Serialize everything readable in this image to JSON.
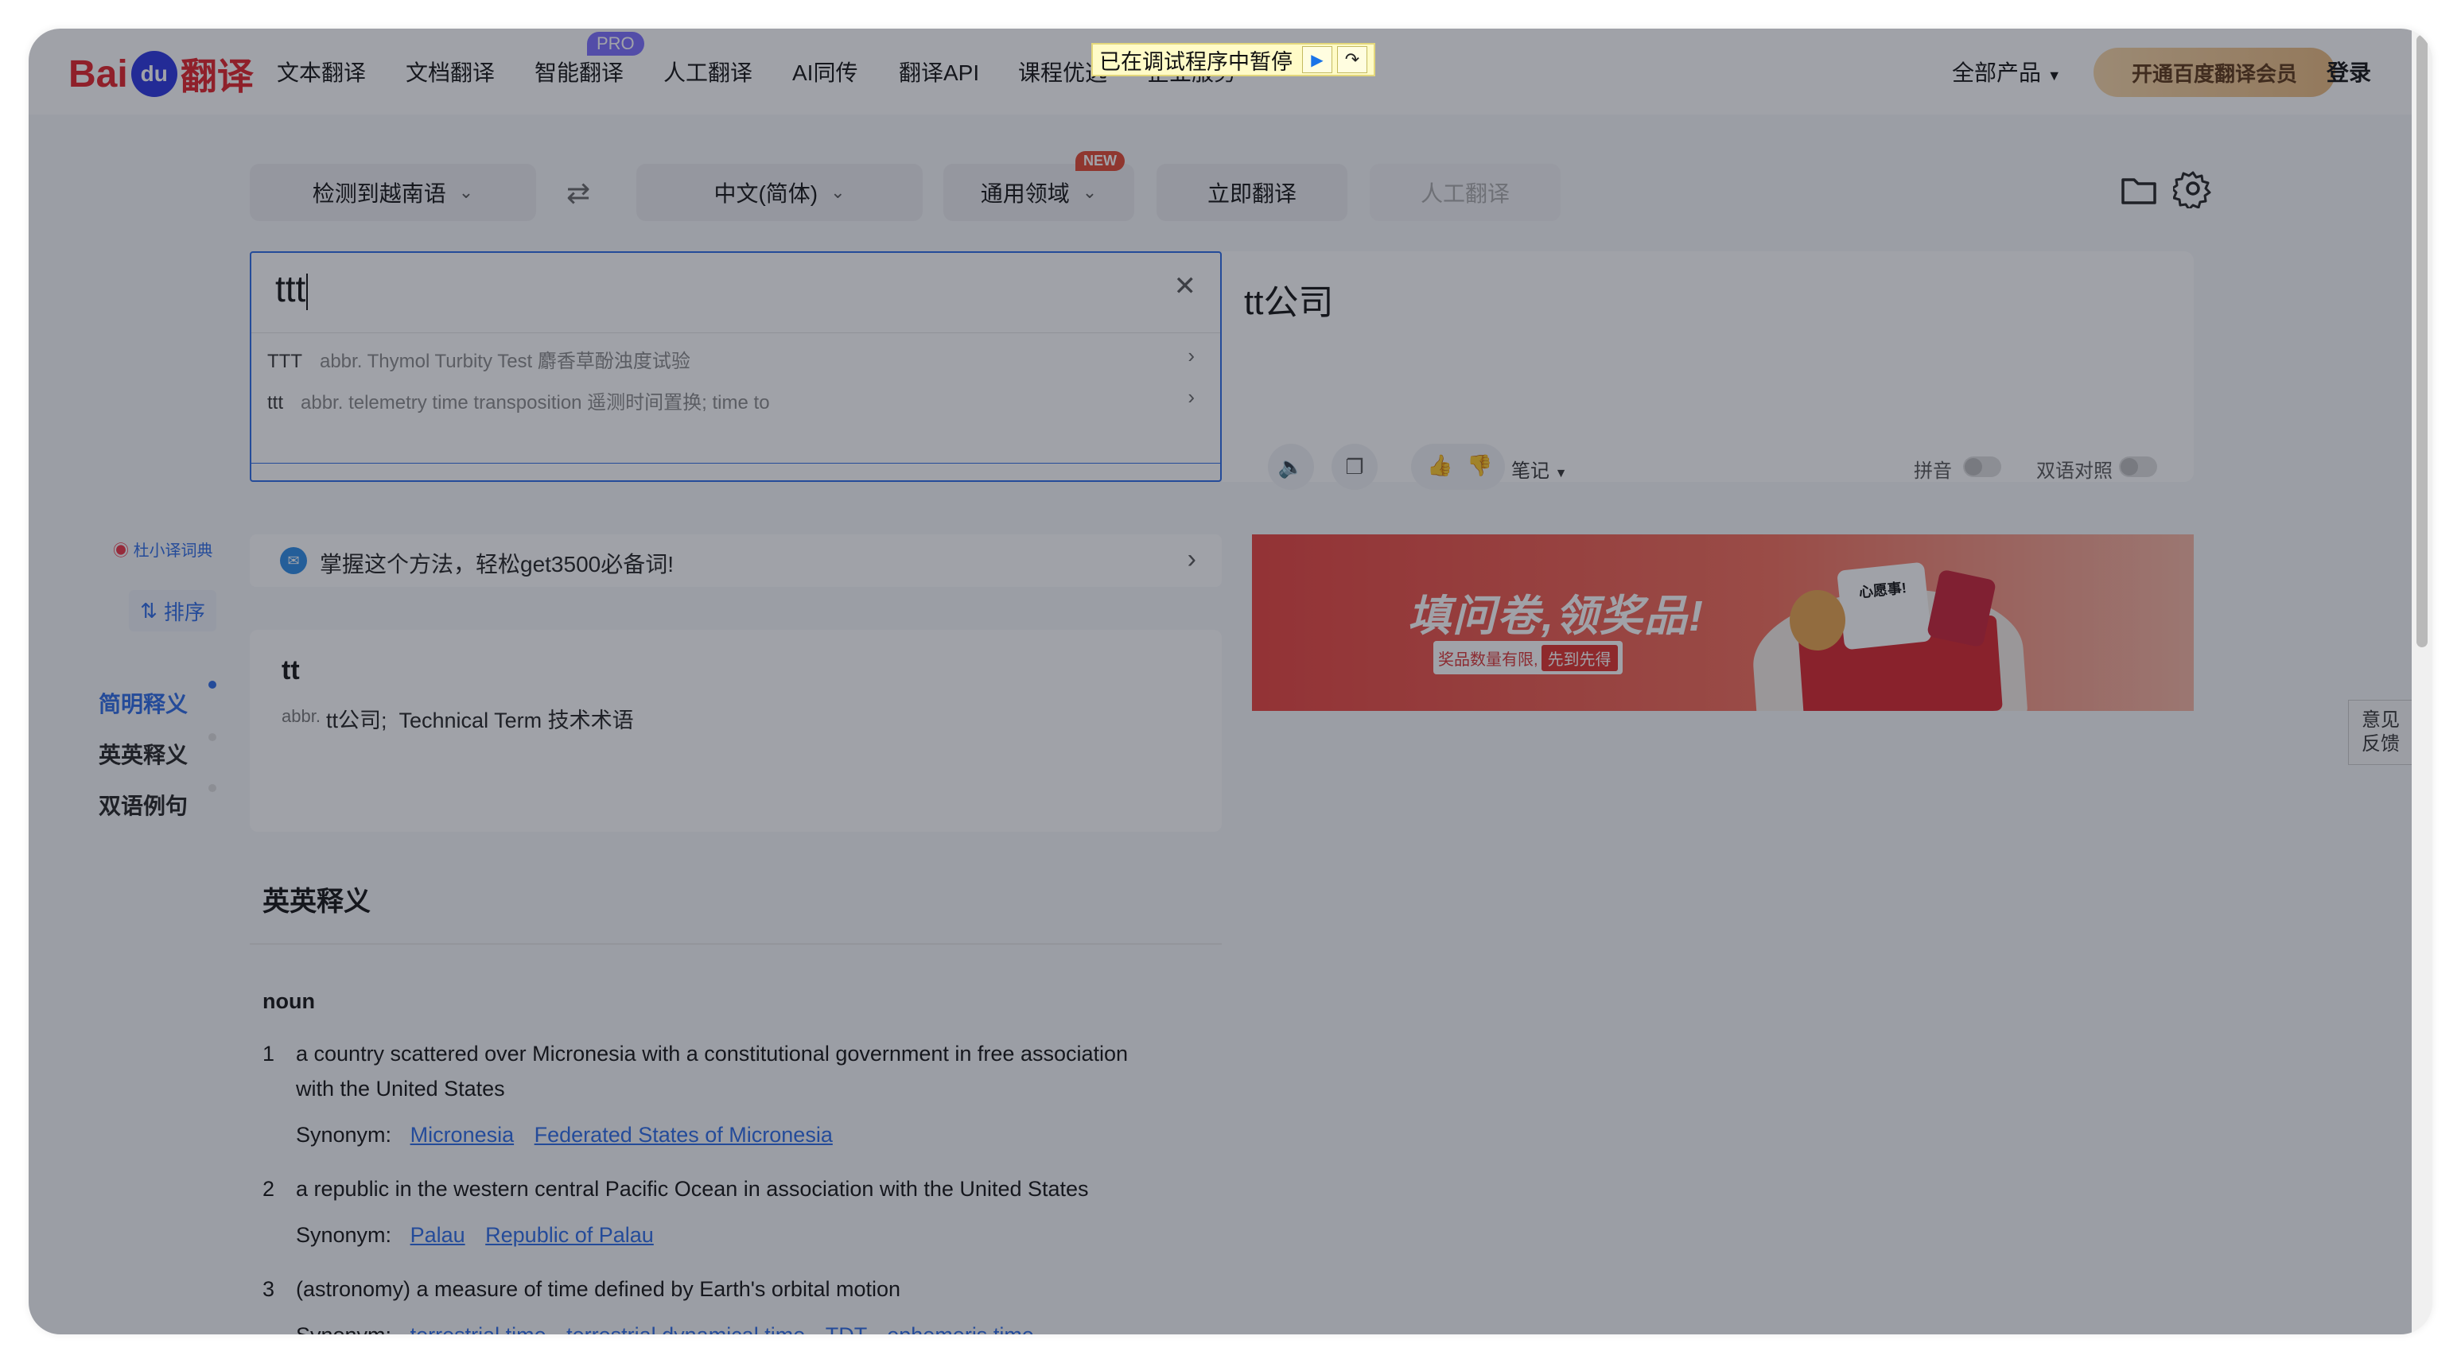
{
  "header": {
    "logo_bai": "Bai",
    "logo_du": "du",
    "logo_fanyi": "翻译",
    "nav": [
      "文本翻译",
      "文档翻译",
      "智能翻译",
      "人工翻译",
      "AI同传",
      "翻译API",
      "课程优选",
      "企业服务"
    ],
    "pro_badge": "PRO",
    "all_products": "全部产品",
    "vip_button": "开通百度翻译会员",
    "login": "登录"
  },
  "debug_banner": {
    "text": "已在调试程序中暂停"
  },
  "toolbar": {
    "source_lang": "检测到越南语",
    "target_lang": "中文(简体)",
    "domain": "通用领域",
    "new_badge": "NEW",
    "translate_button": "立即翻译",
    "human_translate_button": "人工翻译"
  },
  "input": {
    "text": "ttt",
    "suggestions": [
      {
        "word": "TTT",
        "definition": "abbr. Thymol Turbity Test 麝香草酚浊度试验"
      },
      {
        "word": "ttt",
        "definition": "abbr. telemetry time transposition 遥测时间置换; time to"
      }
    ]
  },
  "output": {
    "text": "tt公司",
    "notes_label": "笔记",
    "pinyin_label": "拼音",
    "bilingual_label": "双语对照"
  },
  "sidebar": {
    "dict_source": "杜小译词典",
    "sort_button": "排序",
    "items": [
      "简明释义",
      "英英释义",
      "双语例句"
    ]
  },
  "promo": {
    "text": "掌握这个方法，轻松get3500必备词!"
  },
  "brief_definition": {
    "headword": "tt",
    "pos": "abbr.",
    "meaning": "tt公司;  Technical Term 技术术语"
  },
  "banner": {
    "headline": "填问卷,领奖品!",
    "subline": "奖品数量有限,",
    "cta": "先到先得",
    "bag_text": "心愿事!"
  },
  "feedback": {
    "line1": "意见",
    "line2": "反馈"
  },
  "english_definitions": {
    "title": "英英释义",
    "pos": "noun",
    "synonym_label": "Synonym:",
    "senses": [
      {
        "num": "1",
        "text": "a country scattered over Micronesia with a constitutional government in free association",
        "text2": "with the United States",
        "synonyms": [
          "Micronesia",
          "Federated States of Micronesia"
        ]
      },
      {
        "num": "2",
        "text": "a republic in the western central Pacific Ocean in association with the United States",
        "synonyms": [
          "Palau",
          "Republic of Palau"
        ]
      },
      {
        "num": "3",
        "text": "(astronomy) a measure of time defined by Earth's orbital motion",
        "synonyms": [
          "terrestrial time",
          "terrestrial dynamical time",
          "TDT",
          "ephemeris time"
        ]
      }
    ]
  }
}
